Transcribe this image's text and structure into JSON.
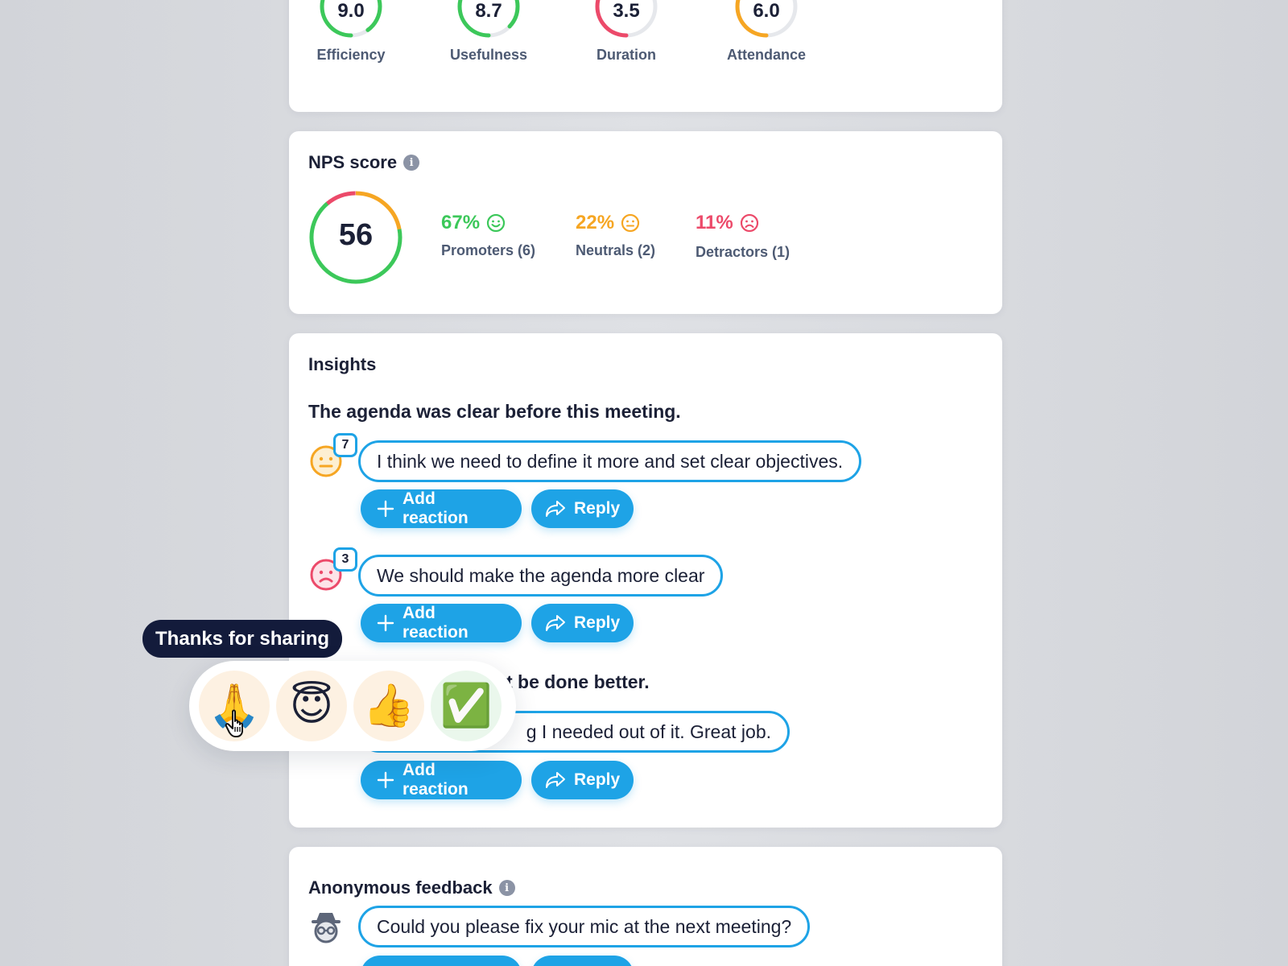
{
  "scores": [
    {
      "value": "9.0",
      "label": "Efficiency",
      "color": "#3cc85a",
      "fraction": 0.9
    },
    {
      "value": "8.7",
      "label": "Usefulness",
      "color": "#3cc85a",
      "fraction": 0.87
    },
    {
      "value": "3.5",
      "label": "Duration",
      "color": "#ec4a6a",
      "fraction": 0.35
    },
    {
      "value": "6.0",
      "label": "Attendance",
      "color": "#f6a623",
      "fraction": 0.6
    }
  ],
  "nps": {
    "title": "NPS score",
    "info_icon": "i",
    "score": "56",
    "promoters": {
      "pct": "67%",
      "label": "Promoters (6)",
      "color": "#3cc85a",
      "icon": "smile-icon"
    },
    "neutrals": {
      "pct": "22%",
      "label": "Neutrals (2)",
      "color": "#f6a623",
      "icon": "neutral-face-icon"
    },
    "detractors": {
      "pct": "11%",
      "label": "Detractors (1)",
      "color": "#ec4a6a",
      "icon": "frown-icon"
    }
  },
  "insights": {
    "title": "Insights",
    "question_1": "The agenda was clear before this meeting.",
    "question_2_visible_part": "t be done better.",
    "comments": [
      {
        "count": "7",
        "mood": "neutral",
        "text": "I think we need to define it more and set clear objectives."
      },
      {
        "count": "3",
        "mood": "sad",
        "text": "We should make the agenda more clear"
      },
      {
        "text_visible_part": "g I needed out of it. Great job."
      }
    ],
    "add_reaction_label": "Add reaction",
    "reply_label": "Reply"
  },
  "anonymous": {
    "title": "Anonymous feedback",
    "info_icon": "i",
    "comment": "Could you please fix your mic at the next meeting?"
  },
  "reaction_popup": {
    "tooltip": "Thanks for sharing",
    "reactions": [
      {
        "name": "folded-hands",
        "glyph": "🙏"
      },
      {
        "name": "smiling-face-with-halo",
        "glyph": "😇"
      },
      {
        "name": "thumbs-up",
        "glyph": "👍"
      },
      {
        "name": "check-mark-button",
        "glyph": "✅"
      }
    ]
  },
  "colors": {
    "accent": "#1ea3e6",
    "green": "#3cc85a",
    "orange": "#f6a623",
    "red": "#ec4a6a",
    "navy": "#131b3b"
  }
}
